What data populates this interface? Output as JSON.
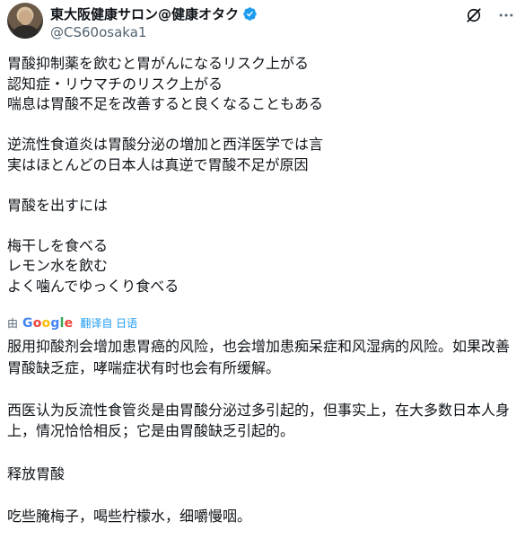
{
  "author": {
    "display_name": "東大阪健康サロン@健康オタク",
    "handle": "@CS60osaka1"
  },
  "tweet": {
    "original_text": "胃酸抑制薬を飲むと胃がんになるリスク上がる\n認知症・リウマチのリスク上がる\n喘息は胃酸不足を改善すると良くなることもある\n\n逆流性食道炎は胃酸分泌の増加と西洋医学では言\n実はほとんどの日本人は真逆で胃酸不足が原因\n\n胃酸を出すには\n\n梅干しを食べる\nレモン水を飲む\nよく噛んでゆっくり食べる",
    "translated_text": "服用抑酸剂会增加患胃癌的风险，也会增加患痴呆症和风湿病的风险。如果改善胃酸缺乏症，哮喘症状有时也会有所缓解。\n\n西医认为反流性食管炎是由胃酸分泌过多引起的，但事实上，在大多数日本人身上，情况恰恰相反；它是由胃酸缺乏引起的。\n\n释放胃酸\n\n吃些腌梅子，喝些柠檬水，细嚼慢咽。"
  },
  "translation": {
    "by_label": "由",
    "google_letters": [
      "G",
      "o",
      "o",
      "g",
      "l",
      "e"
    ],
    "translated_from_label": "翻译自 日语"
  },
  "icons": {
    "verified": "verified-badge-icon",
    "grok": "grok-icon",
    "more": "more-icon"
  },
  "colors": {
    "accent": "#1d9bf0",
    "muted": "#536471",
    "text": "#0f1419"
  }
}
